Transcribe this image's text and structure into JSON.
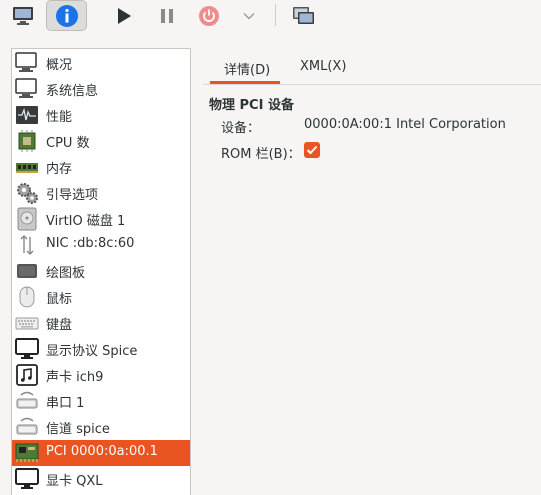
{
  "toolbar": {
    "buttons": [
      {
        "name": "console-icon"
      },
      {
        "name": "info-icon"
      },
      {
        "name": "run-icon"
      },
      {
        "name": "pause-icon"
      },
      {
        "name": "power-icon"
      },
      {
        "name": "chevron-down-icon"
      },
      {
        "name": "snapshot-icon"
      }
    ],
    "accent_color": "#1a73e8"
  },
  "device_list": {
    "items": [
      {
        "label": "概况",
        "icon": "monitor-icon"
      },
      {
        "label": "系统信息",
        "icon": "monitor-icon"
      },
      {
        "label": "性能",
        "icon": "performance-icon"
      },
      {
        "label": "CPU 数",
        "icon": "cpu-icon"
      },
      {
        "label": "内存",
        "icon": "memory-icon"
      },
      {
        "label": "引导选项",
        "icon": "gears-icon"
      },
      {
        "label": "VirtIO 磁盘 1",
        "icon": "disk-icon"
      },
      {
        "label": "NIC :db:8c:60",
        "icon": "network-icon"
      },
      {
        "label": "绘图板",
        "icon": "tablet-icon"
      },
      {
        "label": "鼠标",
        "icon": "mouse-icon"
      },
      {
        "label": "键盘",
        "icon": "keyboard-icon"
      },
      {
        "label": "显示协议 Spice",
        "icon": "display-icon"
      },
      {
        "label": "声卡 ich9",
        "icon": "sound-icon"
      },
      {
        "label": "串口 1",
        "icon": "serial-icon"
      },
      {
        "label": "信道 spice",
        "icon": "channel-icon"
      },
      {
        "label": "PCI 0000:0a:00.1",
        "icon": "pci-card-icon",
        "selected": true
      },
      {
        "label": "显卡 QXL",
        "icon": "display-icon"
      }
    ],
    "selected_color": "#e95420"
  },
  "tabs": [
    {
      "label": "详情(D)",
      "active": true
    },
    {
      "label": "XML(X)",
      "active": false
    }
  ],
  "details": {
    "section_title": "物理 PCI 设备",
    "device_label": "设备：",
    "device_value": "0000:0A:00:1 Intel Corporation",
    "rom_label": "ROM 栏(B)：",
    "rom_checked": true
  }
}
